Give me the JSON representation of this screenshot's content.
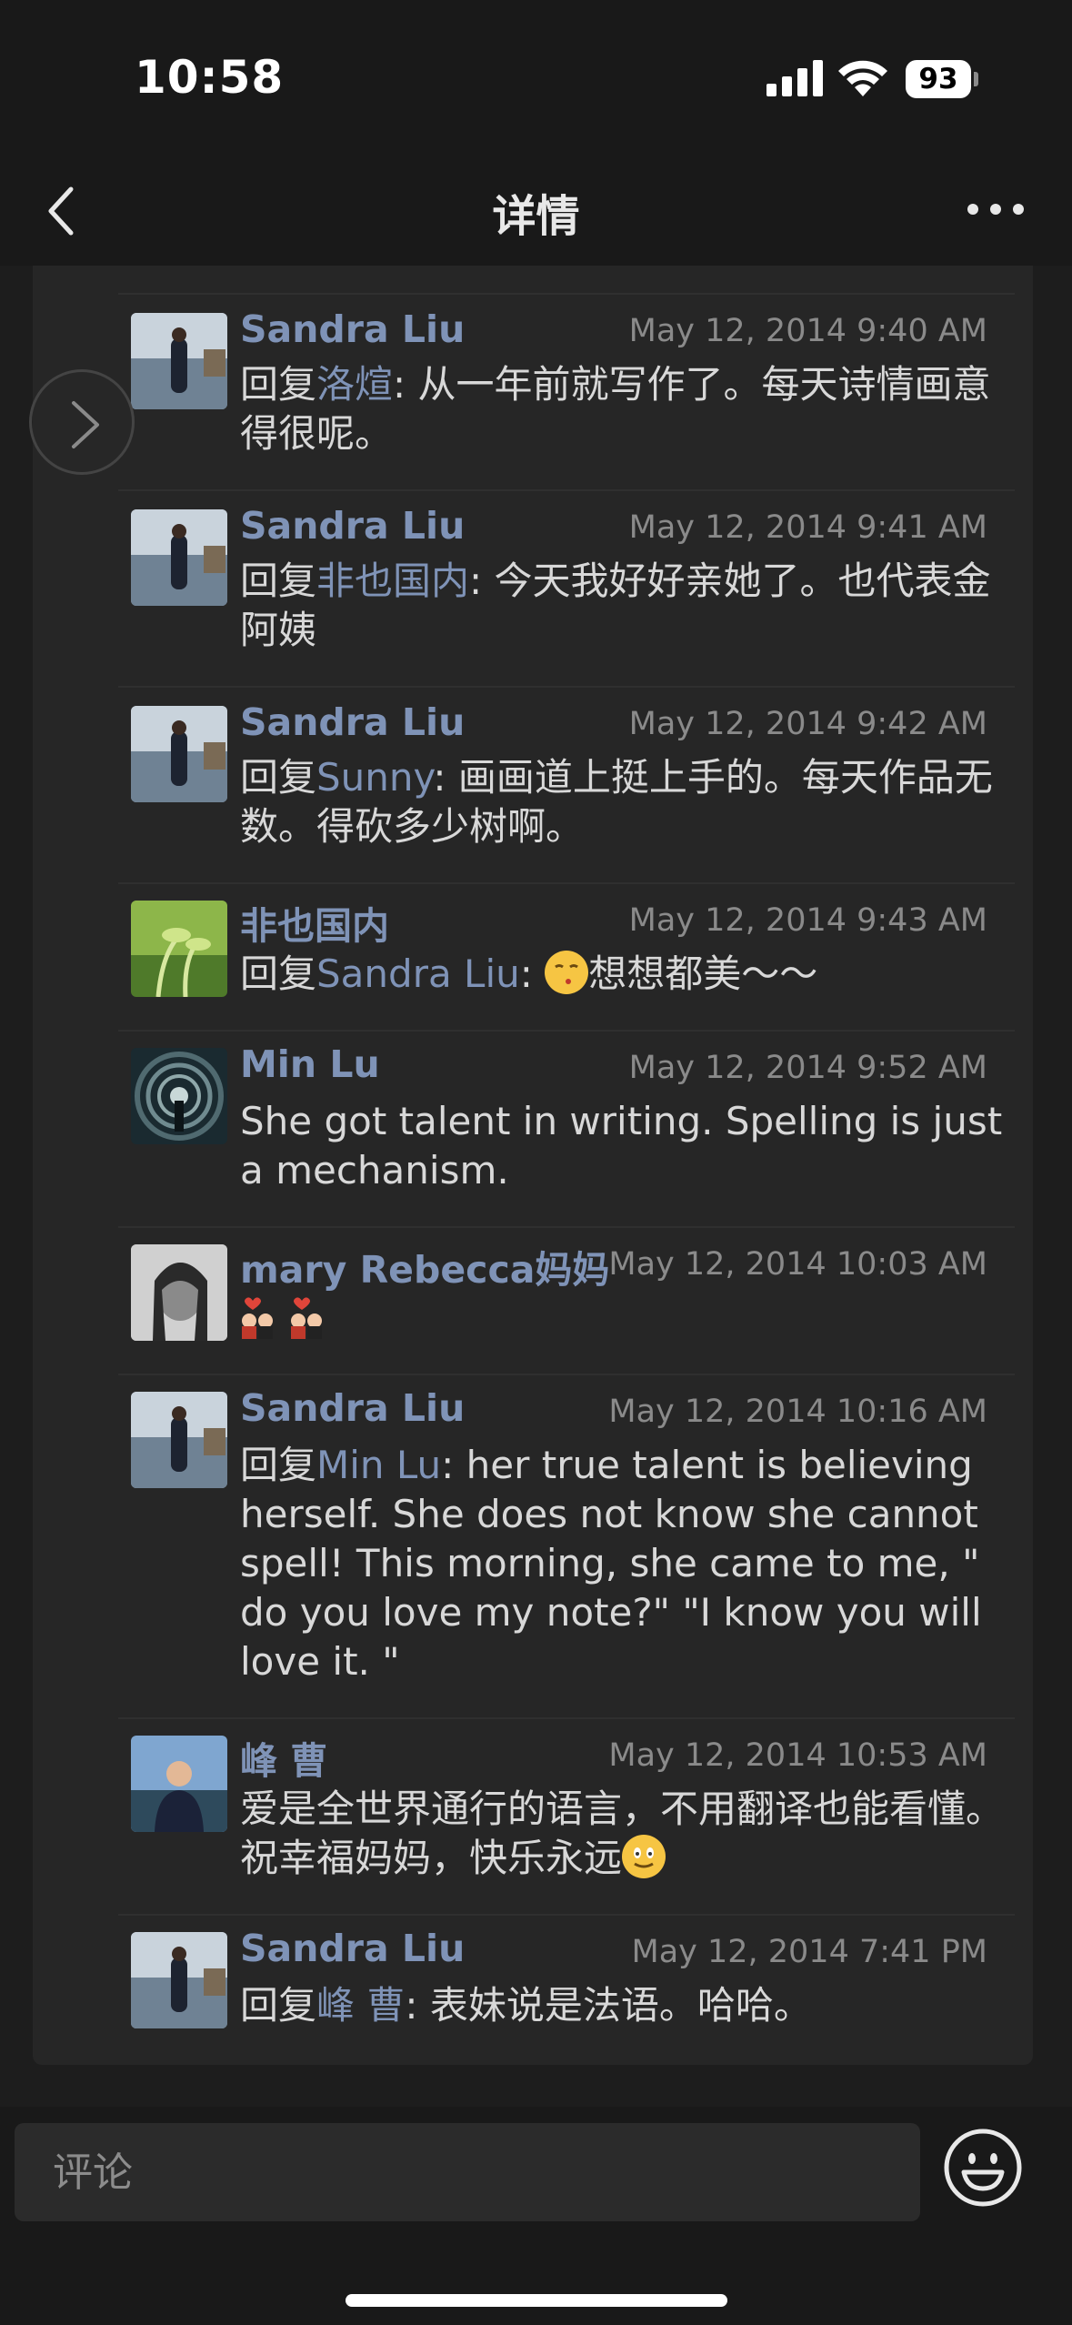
{
  "status_bar": {
    "time": "10:58",
    "battery": "93"
  },
  "nav": {
    "title": "详情"
  },
  "comments": [
    {
      "name": "Sandra Liu",
      "time": "May 12, 2014 9:40 AM",
      "prefix": "回复",
      "mention": "洛煊",
      "body": ": 从一年前就写作了。每天诗情画意得很呢。",
      "avatar": "avatar-sandra"
    },
    {
      "name": "Sandra Liu",
      "time": "May 12, 2014 9:41 AM",
      "prefix": "回复",
      "mention": "非也国内",
      "body": ": 今天我好好亲她了。也代表金阿姨",
      "avatar": "avatar-sandra"
    },
    {
      "name": "Sandra Liu",
      "time": "May 12, 2014 9:42 AM",
      "prefix": "回复",
      "mention": "Sunny",
      "body": ": 画画道上挺上手的。每天作品无数。得砍多少树啊。",
      "avatar": "avatar-sandra"
    },
    {
      "name": "非也国内",
      "time": "May 12, 2014 9:43 AM",
      "prefix": "回复",
      "mention": "Sandra Liu",
      "body_pre": ": ",
      "body": "想想都美～～",
      "emoji": "kiss-emoji",
      "avatar": "avatar-sprout"
    },
    {
      "name": "Min Lu",
      "time": "May 12, 2014 9:52 AM",
      "body": "She got talent in writing. Spelling is just a mechanism.",
      "avatar": "avatar-tunnel"
    },
    {
      "name": "mary Rebecca妈妈",
      "time": "May 12, 2014 10:03 AM",
      "body": "",
      "emoji": "couple-emoji",
      "avatar": "avatar-mary"
    },
    {
      "name": "Sandra Liu",
      "time": "May 12, 2014 10:16 AM",
      "prefix": "回复",
      "mention": "Min Lu",
      "body": ": her true talent is believing herself. She does not know she cannot spell!  This morning, she came to me, \" do you love my note?\"  \"I know you will love it. \"",
      "avatar": "avatar-sandra"
    },
    {
      "name": "峰 曹",
      "time": "May 12, 2014 10:53 AM",
      "body": "爱是全世界通行的语言，不用翻译也能看懂。祝幸福妈妈，快乐永远",
      "emoji": "smile-emoji",
      "avatar": "avatar-feng"
    },
    {
      "name": "Sandra Liu",
      "time": "May 12, 2014 7:41 PM",
      "prefix": "回复",
      "mention": "峰 曹",
      "body": ": 表妹说是法语。哈哈。",
      "avatar": "avatar-sandra"
    }
  ],
  "input": {
    "placeholder": "评论"
  }
}
